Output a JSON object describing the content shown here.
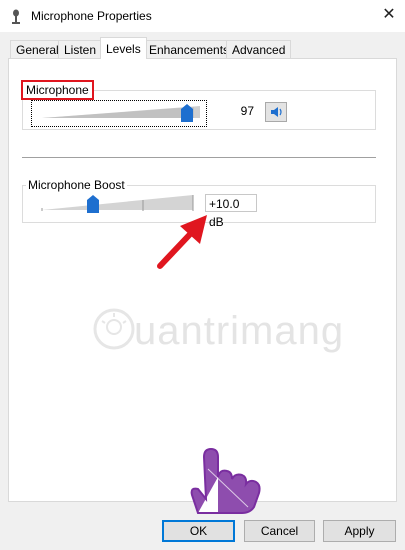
{
  "window": {
    "title": "Microphone Properties",
    "close_glyph": "✕"
  },
  "tabs": [
    {
      "label": "General",
      "active": false
    },
    {
      "label": "Listen",
      "active": false
    },
    {
      "label": "Levels",
      "active": true
    },
    {
      "label": "Enhancements",
      "active": false
    },
    {
      "label": "Advanced",
      "active": false
    }
  ],
  "levels": {
    "microphone": {
      "label": "Microphone",
      "value": "97",
      "level_fraction": 0.97,
      "speaker_icon": "speaker-icon"
    },
    "boost": {
      "label": "Microphone Boost",
      "value": "+10.0 dB",
      "level_fraction": 0.33
    }
  },
  "annotations": {
    "highlight_color": "#e0161f",
    "arrow_color": "#e0161f"
  },
  "watermark": {
    "text": "uantrimang"
  },
  "buttons": {
    "ok": "OK",
    "cancel": "Cancel",
    "apply": "Apply"
  },
  "colors": {
    "accent": "#0078d7",
    "thumb": "#1e6fcf"
  }
}
